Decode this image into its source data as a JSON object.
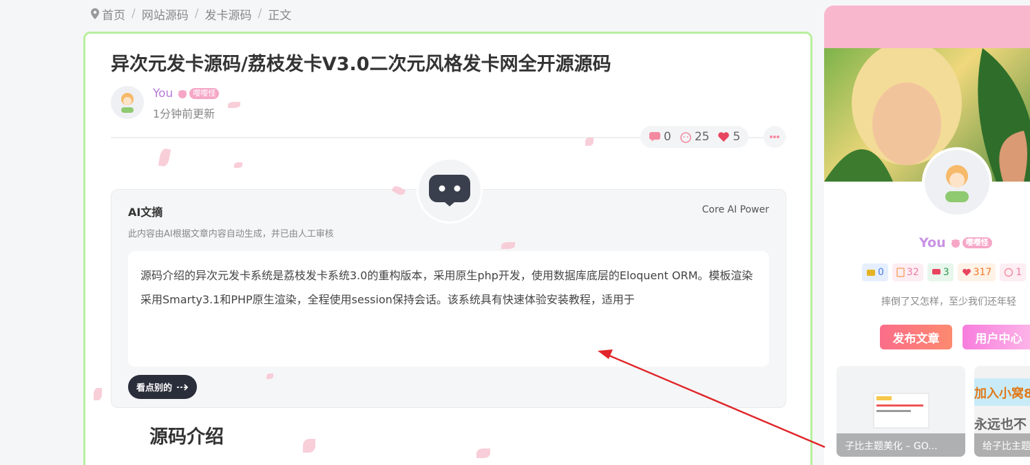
{
  "breadcrumb": [
    "首页",
    "网站源码",
    "发卡源码",
    "正文"
  ],
  "post": {
    "title": "异次元发卡源码/荔枝发卡V3.0二次元风格发卡网全开源源码",
    "author": "You",
    "author_tag": "嘤嘤怪",
    "updated": "1分钟前更新",
    "stats": {
      "comments": "0",
      "likes": "25",
      "favorites": "5"
    }
  },
  "ai_summary": {
    "title": "AI文摘",
    "power": "Core AI Power",
    "subtitle": "此内容由AI根据文章内容自动生成，并已由人工审核",
    "content": "源码介绍的异次元发卡系统是荔枝发卡系统3.0的重构版本，采用原生php开发，使用数据库底层的Eloquent ORM。模板渲染采用Smarty3.1和PHP原生渲染，全程使用session保持会话。该系统具有快速体验安装教程，适用于",
    "button": "看点别的"
  },
  "section_heading": "源码介绍",
  "sidebar": {
    "name": "You",
    "name_tag": "嘤嘤怪",
    "stats": [
      "0",
      "32",
      "3",
      "317",
      "1"
    ],
    "motto": "摔倒了又怎样，至少我们还年轻",
    "btn_post": "发布文章",
    "btn_user": "用户中心",
    "thumbs": [
      "子比主题美化 – GO...",
      "给子比主题"
    ],
    "thumb2_text_1": "加入小窝8",
    "thumb2_text_2": "永远也不"
  },
  "colors": {
    "accent_green": "#b7ef9e",
    "author": "#b77bd9",
    "post_btn": "#fb6d89"
  }
}
